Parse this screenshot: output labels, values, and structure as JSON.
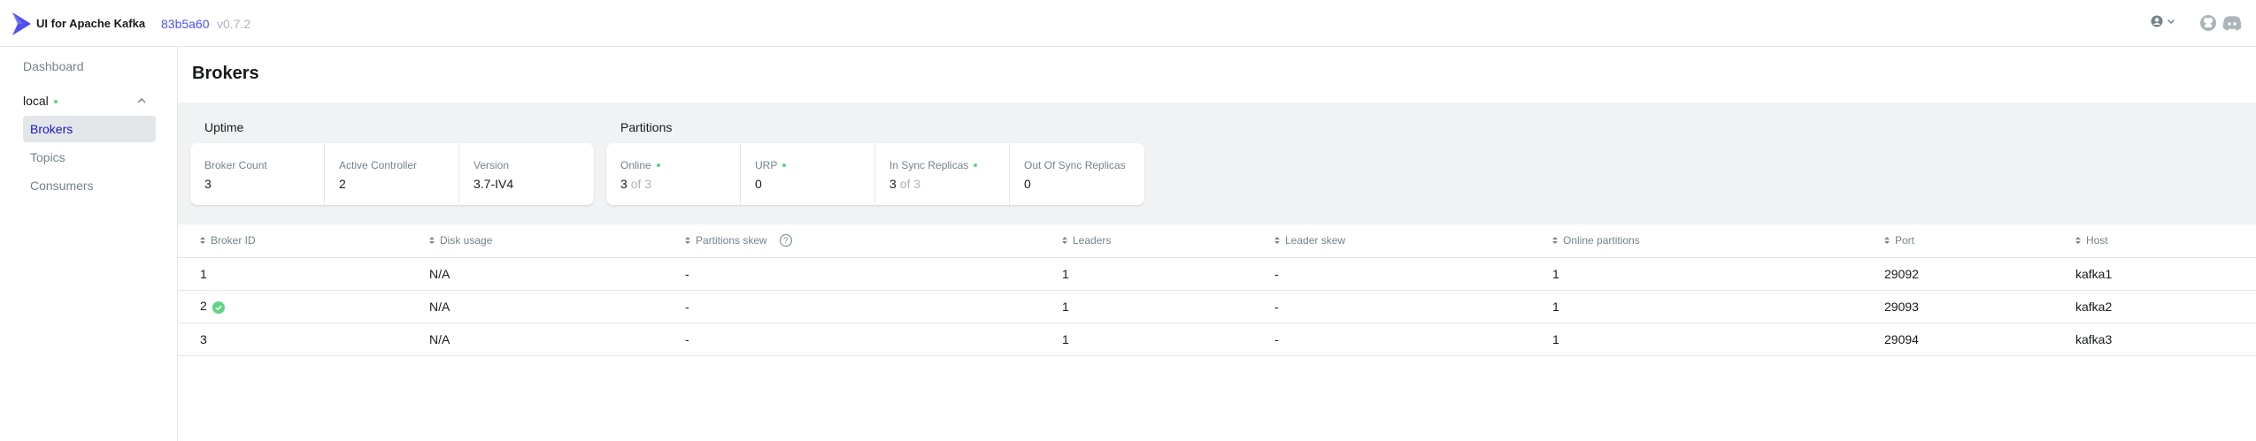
{
  "header": {
    "brand": "UI for Apache Kafka",
    "commit": "83b5a60",
    "version": "v0.7.2",
    "icons": [
      "user-menu-icon",
      "github-icon",
      "discord-icon"
    ]
  },
  "sidebar": {
    "dashboard": "Dashboard",
    "cluster": "local",
    "items": [
      {
        "label": "Brokers",
        "active": true
      },
      {
        "label": "Topics",
        "active": false
      },
      {
        "label": "Consumers",
        "active": false
      }
    ]
  },
  "page": {
    "title": "Brokers",
    "uptime": {
      "title": "Uptime",
      "cards": [
        {
          "label": "Broker Count",
          "value": "3"
        },
        {
          "label": "Active Controller",
          "value": "2"
        },
        {
          "label": "Version",
          "value": "3.7-IV4"
        }
      ]
    },
    "partitions": {
      "title": "Partitions",
      "cards": [
        {
          "label": "Online",
          "value": "3",
          "suffix": "of 3"
        },
        {
          "label": "URP",
          "value": "0"
        },
        {
          "label": "In Sync Replicas",
          "value": "3",
          "suffix": "of 3"
        },
        {
          "label": "Out Of Sync Replicas",
          "value": "0"
        }
      ]
    }
  },
  "table": {
    "columns": [
      "Broker ID",
      "Disk usage",
      "Partitions skew",
      "Leaders",
      "Leader skew",
      "Online partitions",
      "Port",
      "Host"
    ],
    "rows": [
      {
        "id": "1",
        "disk": "N/A",
        "pskew": "-",
        "leaders": "1",
        "lskew": "-",
        "online": "1",
        "port": "29092",
        "host": "kafka1"
      },
      {
        "id": "2",
        "disk": "N/A",
        "pskew": "-",
        "leaders": "1",
        "lskew": "-",
        "online": "1",
        "port": "29093",
        "host": "kafka2"
      },
      {
        "id": "3",
        "disk": "N/A",
        "pskew": "-",
        "leaders": "1",
        "lskew": "-",
        "online": "1",
        "port": "29094",
        "host": "kafka3"
      }
    ]
  },
  "colors": {
    "accent": "#4f4ff5",
    "active_link": "#1717cf",
    "ok": "#5cd685",
    "muted": "#abb5ba"
  }
}
